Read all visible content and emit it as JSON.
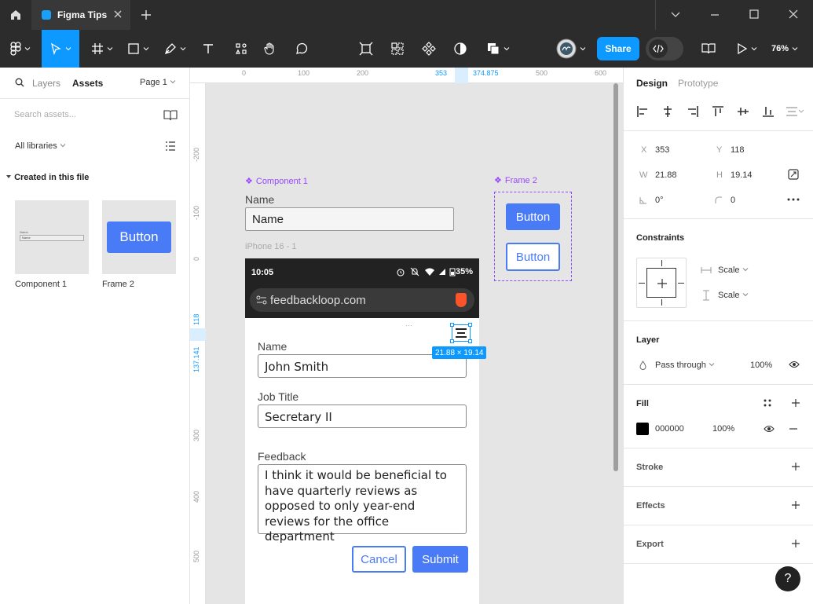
{
  "titlebar": {
    "tab_title": "Figma Tips"
  },
  "toolbar": {
    "share_label": "Share",
    "zoom_label": "76%"
  },
  "left_panel": {
    "tab_layers": "Layers",
    "tab_assets": "Assets",
    "page_label": "Page 1",
    "search_placeholder": "Search assets...",
    "libraries_label": "All libraries",
    "section_title": "Created in this file",
    "assets": [
      {
        "name": "Component 1",
        "thumb_label": "Name",
        "thumb_field": "Name"
      },
      {
        "name": "Frame 2",
        "thumb_button": "Button"
      }
    ]
  },
  "canvas": {
    "ruler_top": [
      "0",
      "100",
      "200",
      "353",
      "374.875",
      "500",
      "600"
    ],
    "ruler_left": [
      "-200",
      "-100",
      "0",
      "118",
      "137.141",
      "300",
      "400",
      "500"
    ],
    "component1": {
      "title": "Component 1",
      "label": "Name",
      "input_value": "Name"
    },
    "frame2": {
      "title": "Frame 2",
      "button_primary": "Button",
      "button_outline": "Button"
    },
    "iphone": {
      "frame_name": "iPhone 16 - 1",
      "time": "10:05",
      "battery": "35%",
      "url": "feedbackloop.com",
      "name_label": "Name",
      "name_value": "John Smith",
      "job_label": "Job Title",
      "job_value": "Secretary II",
      "feedback_label": "Feedback",
      "feedback_value": "I think it would be beneficial to have quarterly reviews as opposed to only year-end reviews for the office department",
      "cancel_label": "Cancel",
      "submit_label": "Submit"
    },
    "selection_dims": "21.88 × 19.14"
  },
  "right_panel": {
    "tab_design": "Design",
    "tab_prototype": "Prototype",
    "x_label": "X",
    "x_value": "353",
    "y_label": "Y",
    "y_value": "118",
    "w_label": "W",
    "w_value": "21.88",
    "h_label": "H",
    "h_value": "19.14",
    "rotation_value": "0°",
    "radius_value": "0",
    "constraints_title": "Constraints",
    "constraint_h": "Scale",
    "constraint_v": "Scale",
    "layer_title": "Layer",
    "blend_mode": "Pass through",
    "layer_opacity": "100%",
    "fill_title": "Fill",
    "fill_hex": "000000",
    "fill_opacity": "100%",
    "stroke_title": "Stroke",
    "effects_title": "Effects",
    "export_title": "Export",
    "help_label": "?"
  },
  "colors": {
    "accent": "#0d99ff",
    "component_purple": "#9747ff",
    "button_blue": "#4a7bf7",
    "fill_swatch": "#000000"
  }
}
